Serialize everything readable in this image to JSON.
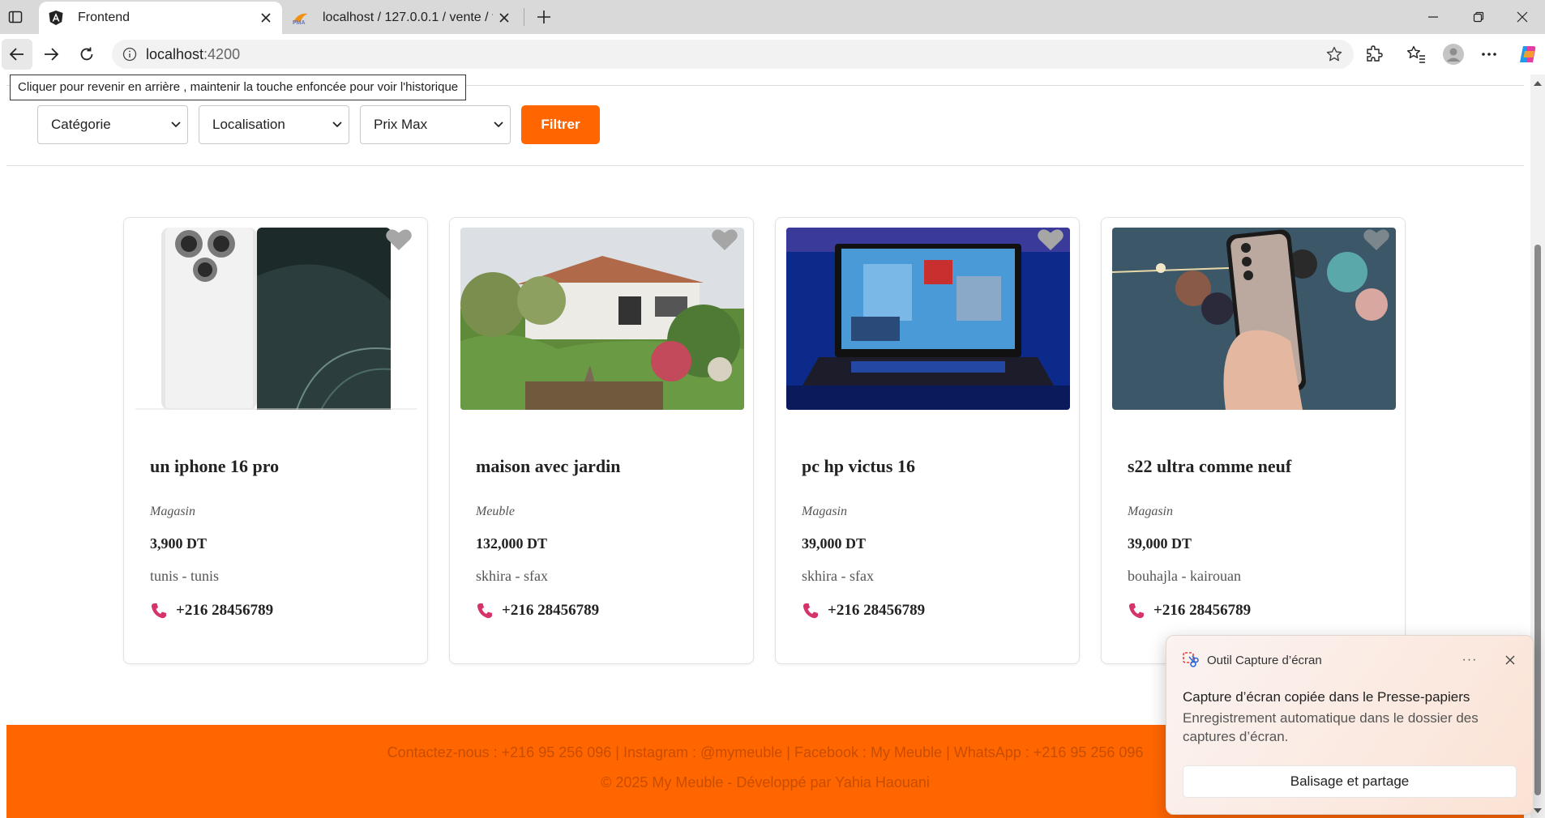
{
  "browser": {
    "tabs": [
      {
        "title": "Frontend",
        "favicon": "angular-icon",
        "active": true
      },
      {
        "title": "localhost / 127.0.0.1 / vente / favo",
        "favicon": "phpmyadmin-icon",
        "active": false
      }
    ],
    "url_host": "localhost",
    "url_port": ":4200",
    "back_tooltip": "Cliquer pour revenir en arrière , maintenir la touche enfoncée pour voir l'historique"
  },
  "filters": {
    "category": "Catégorie",
    "location": "Localisation",
    "max_price": "Prix Max",
    "submit_label": "Filtrer"
  },
  "listings": [
    {
      "title": "un iphone 16 pro",
      "category": "Magasin",
      "price": "3,900 DT",
      "location": "tunis - tunis",
      "phone": "+216 28456789"
    },
    {
      "title": "maison avec jardin",
      "category": "Meuble",
      "price": "132,000 DT",
      "location": "skhira - sfax",
      "phone": "+216 28456789"
    },
    {
      "title": "pc hp victus 16",
      "category": "Magasin",
      "price": "39,000 DT",
      "location": "skhira - sfax",
      "phone": "+216 28456789"
    },
    {
      "title": "s22 ultra comme neuf",
      "category": "Magasin",
      "price": "39,000 DT",
      "location": "bouhajla - kairouan",
      "phone": "+216 28456789"
    }
  ],
  "footer": {
    "contact": "Contactez-nous : +216 95 256 096 | Instagram : @mymeuble | Facebook : My Meuble | WhatsApp : +216 95 256 096",
    "copyright": "© 2025 My Meuble - Développé par Yahia Haouani"
  },
  "toast": {
    "app_name": "Outil Capture d’écran",
    "more_label": "···",
    "title": "Capture d’écran copiée dans le Presse-papiers",
    "body": "Enregistrement automatique dans le dossier des captures d’écran.",
    "action_label": "Balisage et partage"
  },
  "colors": {
    "accent": "#ff6600",
    "footer_text": "#c84d00",
    "phone_icon": "#d6336c"
  }
}
